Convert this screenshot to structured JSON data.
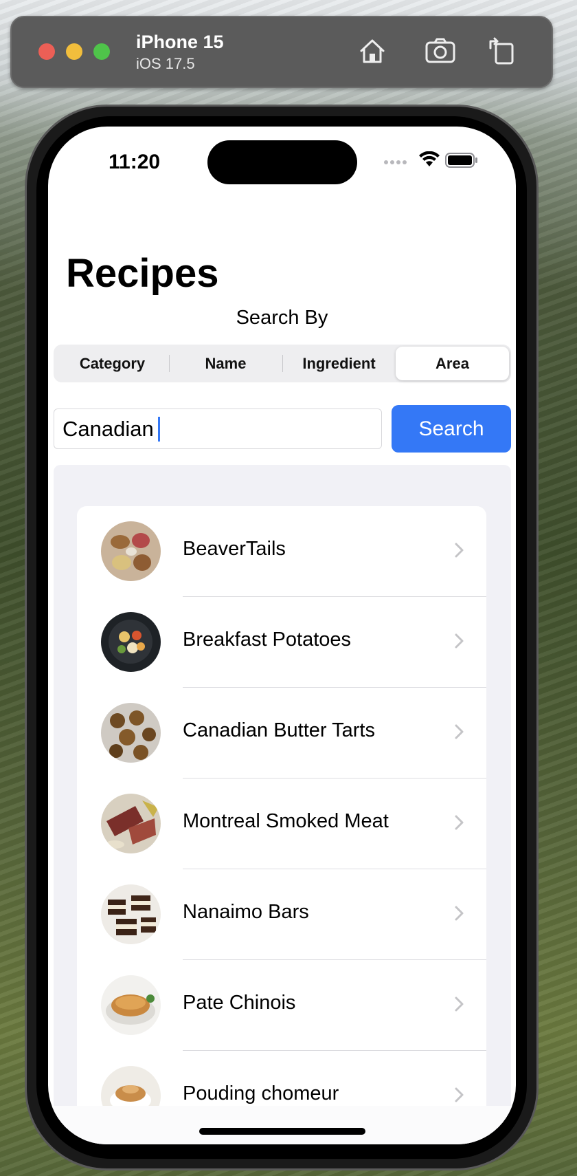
{
  "simulator": {
    "device_name": "iPhone 15",
    "os_version": "iOS 17.5",
    "toolbar_buttons": [
      "home-icon",
      "screenshot-icon",
      "rotate-icon"
    ]
  },
  "status_bar": {
    "time": "11:20",
    "icons": [
      "cellular-dots-icon",
      "wifi-icon",
      "battery-icon"
    ]
  },
  "page": {
    "title": "Recipes",
    "search_by_label": "Search By"
  },
  "segmented_control": {
    "options": [
      "Category",
      "Name",
      "Ingredient",
      "Area"
    ],
    "selected": "Area"
  },
  "search": {
    "value": "Canadian",
    "button_label": "Search"
  },
  "recipes": [
    {
      "name": "BeaverTails"
    },
    {
      "name": "Breakfast Potatoes"
    },
    {
      "name": "Canadian Butter Tarts"
    },
    {
      "name": "Montreal Smoked Meat"
    },
    {
      "name": "Nanaimo Bars"
    },
    {
      "name": "Pate Chinois"
    },
    {
      "name": "Pouding chomeur"
    }
  ],
  "colors": {
    "accent": "#3478f6",
    "list_background": "#f1f1f6",
    "segment_background": "#eeeef0"
  }
}
